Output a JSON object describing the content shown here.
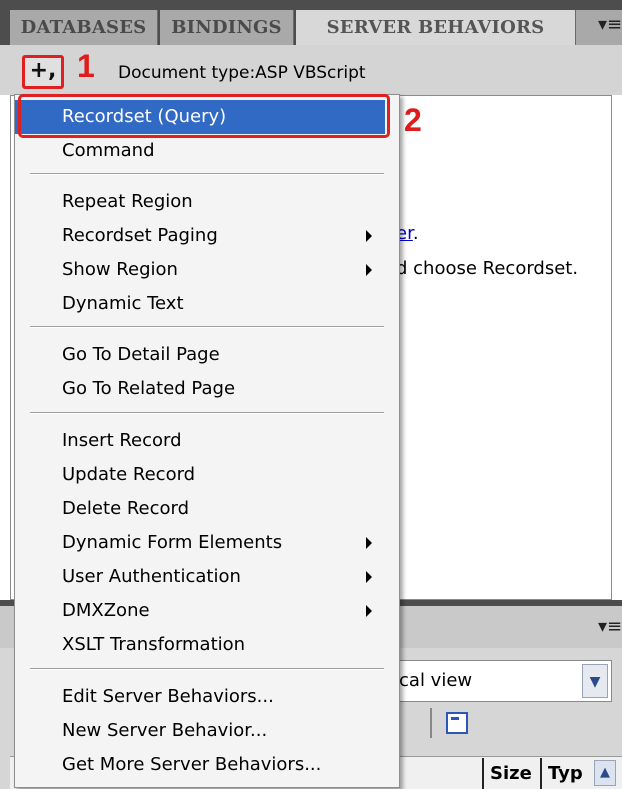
{
  "tabs": [
    {
      "label": "DATABASES",
      "active": false
    },
    {
      "label": "BINDINGS",
      "active": false
    },
    {
      "label": "SERVER BEHAVIORS",
      "active": true
    }
  ],
  "toolbar": {
    "plus_label": "+,",
    "document_type": "Document type:ASP VBScript"
  },
  "annotations": {
    "step1": "1",
    "step2": "2"
  },
  "content": {
    "link_fragment": "er",
    "link_suffix": ".",
    "line2": "d choose Recordset."
  },
  "menu": {
    "items": [
      {
        "label": "Recordset (Query)",
        "selected": true,
        "submenu": false
      },
      {
        "label": "Command",
        "submenu": false
      },
      {
        "label": "Repeat Region",
        "submenu": false
      },
      {
        "label": "Recordset Paging",
        "submenu": true
      },
      {
        "label": "Show Region",
        "submenu": true
      },
      {
        "label": "Dynamic Text",
        "submenu": false
      },
      {
        "label": "Go To Detail Page",
        "submenu": false
      },
      {
        "label": "Go To Related Page",
        "submenu": false
      },
      {
        "label": "Insert Record",
        "submenu": false
      },
      {
        "label": "Update Record",
        "submenu": false
      },
      {
        "label": "Delete Record",
        "submenu": false
      },
      {
        "label": "Dynamic Form Elements",
        "submenu": true
      },
      {
        "label": "User Authentication",
        "submenu": true
      },
      {
        "label": "DMXZone",
        "submenu": true
      },
      {
        "label": "XSLT Transformation",
        "submenu": false
      },
      {
        "label": "Edit Server Behaviors...",
        "submenu": false
      },
      {
        "label": "New Server Behavior...",
        "submenu": false
      },
      {
        "label": "Get More Server Behaviors...",
        "submenu": false
      }
    ]
  },
  "lower_panel": {
    "view_select": "ocal view",
    "columns": [
      "Size",
      "Typ"
    ]
  },
  "colors": {
    "highlight": "#316ac5",
    "annotation_red": "#e02020",
    "tab_bar": "#4d4d4d"
  }
}
